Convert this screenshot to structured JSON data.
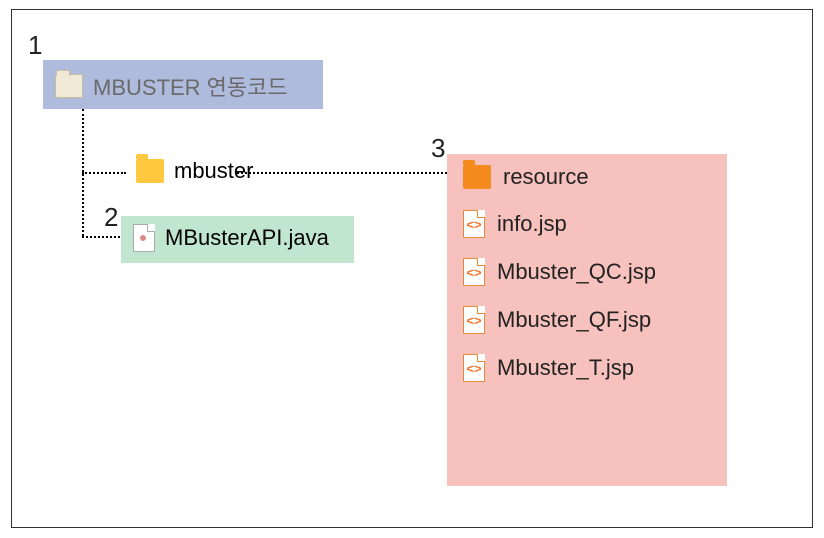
{
  "annotations": {
    "n1": "1",
    "n2": "2",
    "n3": "3"
  },
  "root": {
    "label": "MBUSTER 연동코드"
  },
  "mbuster": {
    "label": "mbuster"
  },
  "api": {
    "label": "MBusterAPI.java"
  },
  "resource": {
    "folder": "resource",
    "files": [
      {
        "name": "info.jsp"
      },
      {
        "name": "Mbuster_QC.jsp"
      },
      {
        "name": "Mbuster_QF.jsp"
      },
      {
        "name": "Mbuster_T.jsp"
      }
    ]
  },
  "jspGlyph": "<>"
}
